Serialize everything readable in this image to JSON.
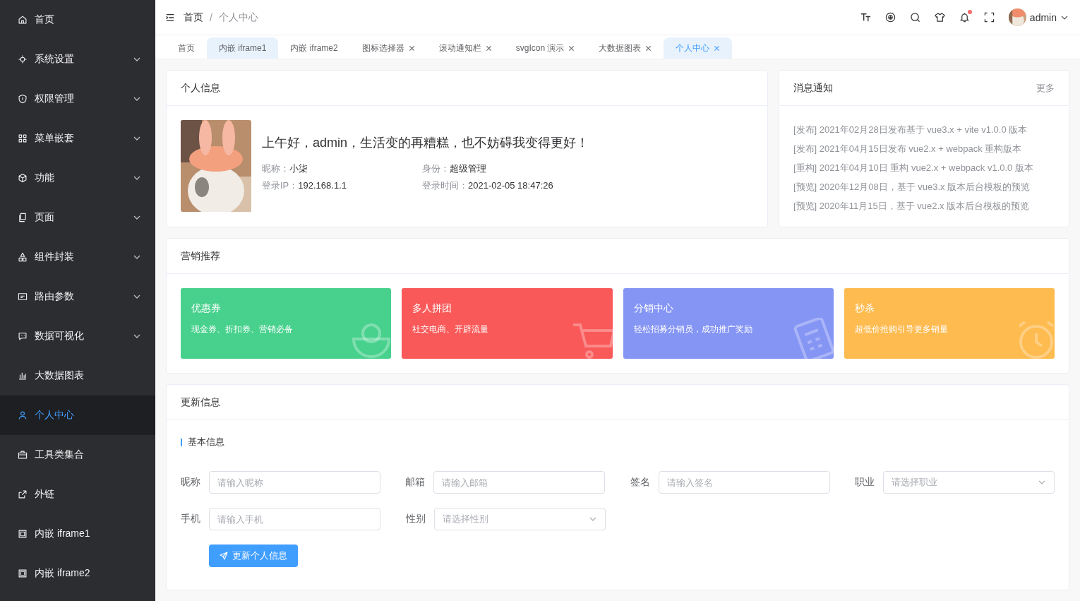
{
  "sidebar": {
    "items": [
      {
        "label": "首页",
        "expandable": false,
        "selected": false
      },
      {
        "label": "系统设置",
        "expandable": true,
        "selected": false
      },
      {
        "label": "权限管理",
        "expandable": true,
        "selected": false
      },
      {
        "label": "菜单嵌套",
        "expandable": true,
        "selected": false
      },
      {
        "label": "功能",
        "expandable": true,
        "selected": false
      },
      {
        "label": "页面",
        "expandable": true,
        "selected": false
      },
      {
        "label": "组件封装",
        "expandable": true,
        "selected": false
      },
      {
        "label": "路由参数",
        "expandable": true,
        "selected": false
      },
      {
        "label": "数据可视化",
        "expandable": true,
        "selected": false
      },
      {
        "label": "大数据图表",
        "expandable": false,
        "selected": false
      },
      {
        "label": "个人中心",
        "expandable": false,
        "selected": true
      },
      {
        "label": "工具类集合",
        "expandable": false,
        "selected": false
      },
      {
        "label": "外链",
        "expandable": false,
        "selected": false
      },
      {
        "label": "内嵌 iframe1",
        "expandable": false,
        "selected": false
      },
      {
        "label": "内嵌 iframe2",
        "expandable": false,
        "selected": false
      }
    ]
  },
  "header": {
    "breadcrumb": [
      "首页",
      "个人中心"
    ],
    "breadcrumb_separator": "/",
    "user": "admin",
    "notification_dot": true
  },
  "tabs": [
    {
      "label": "首页",
      "closable": false,
      "selected": false,
      "hover": false
    },
    {
      "label": "内嵌 iframe1",
      "closable": false,
      "selected": false,
      "hover": true
    },
    {
      "label": "内嵌 iframe2",
      "closable": false,
      "selected": false,
      "hover": false
    },
    {
      "label": "图标选择器",
      "closable": true,
      "selected": false,
      "hover": false
    },
    {
      "label": "滚动通知栏",
      "closable": true,
      "selected": false,
      "hover": false
    },
    {
      "label": "svgIcon 演示",
      "closable": true,
      "selected": false,
      "hover": false
    },
    {
      "label": "大数据图表",
      "closable": true,
      "selected": false,
      "hover": false
    },
    {
      "label": "个人中心",
      "closable": true,
      "selected": true,
      "hover": false
    }
  ],
  "profile": {
    "title": "个人信息",
    "greeting": "上午好，admin，生活变的再糟糕，也不妨碍我变得更好！",
    "fields": [
      {
        "label": "昵称：",
        "value": "小柒"
      },
      {
        "label": "身份：",
        "value": "超级管理"
      },
      {
        "label": "登录IP：",
        "value": "192.168.1.1"
      },
      {
        "label": "登录时间：",
        "value": "2021-02-05 18:47:26"
      }
    ]
  },
  "notices": {
    "title": "消息通知",
    "more": "更多",
    "items": [
      "[发布] 2021年02月28日发布基于 vue3.x + vite v1.0.0 版本",
      "[发布] 2021年04月15日发布 vue2.x + webpack 重构版本",
      "[重构] 2021年04月10日 重构 vue2.x + webpack v1.0.0 版本",
      "[预览] 2020年12月08日，基于 vue3.x 版本后台模板的预览",
      "[预览] 2020年11月15日，基于 vue2.x 版本后台模板的预览"
    ]
  },
  "marketing": {
    "title": "营销推荐",
    "cards": [
      {
        "title": "优惠券",
        "desc": "现金券、折扣券、营销必备",
        "color": "#48d18d"
      },
      {
        "title": "多人拼团",
        "desc": "社交电商、开辟流量",
        "color": "#f95959"
      },
      {
        "title": "分销中心",
        "desc": "轻松招募分销员，成功推广奖励",
        "color": "#8595f4"
      },
      {
        "title": "秒杀",
        "desc": "超低价抢购引导更多销量",
        "color": "#febb50"
      }
    ]
  },
  "update": {
    "title": "更新信息",
    "section": "基本信息",
    "fields": [
      {
        "label": "昵称",
        "placeholder": "请输入昵称",
        "kind": "input"
      },
      {
        "label": "邮箱",
        "placeholder": "请输入邮箱",
        "kind": "input"
      },
      {
        "label": "签名",
        "placeholder": "请输入签名",
        "kind": "input"
      },
      {
        "label": "职业",
        "placeholder": "请选择职业",
        "kind": "select"
      },
      {
        "label": "手机",
        "placeholder": "请输入手机",
        "kind": "input"
      },
      {
        "label": "性别",
        "placeholder": "请选择性别",
        "kind": "select"
      }
    ],
    "button": "更新个人信息"
  }
}
